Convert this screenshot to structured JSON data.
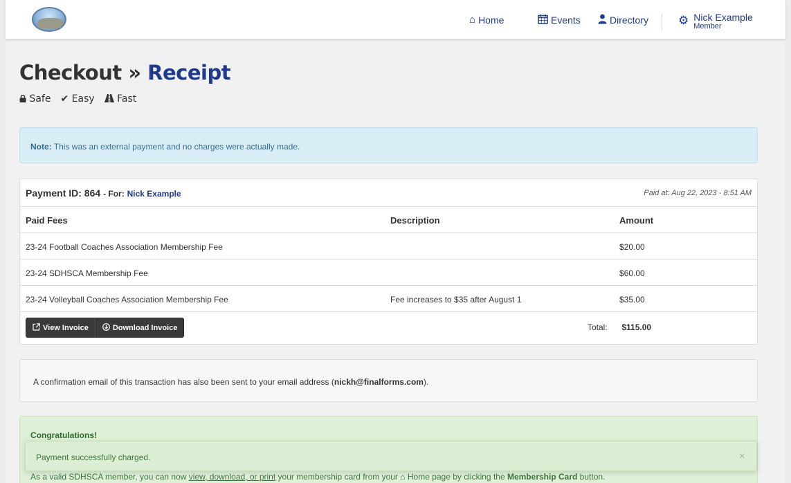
{
  "nav": {
    "home": "Home",
    "home_icon": "home-icon",
    "events": "Events",
    "events_icon": "calendar-icon",
    "directory": "Directory",
    "directory_icon": "user-icon",
    "user_name": "Nick Example",
    "user_role": "Member",
    "user_icon": "gear-icon"
  },
  "page": {
    "title_main": "Checkout »",
    "title_accent": "Receipt",
    "badges": [
      "Safe",
      "Easy",
      "Fast"
    ]
  },
  "note": {
    "label": "Note:",
    "text": "This was an external payment and no charges were actually made."
  },
  "receipt": {
    "payment_id_label": "Payment ID: 864",
    "for_label": "- For:",
    "for_name": "Nick Example",
    "paid_at": "Paid at: Aug 22, 2023 - 8:51 AM",
    "columns": [
      "Paid Fees",
      "Description",
      "Amount"
    ],
    "rows": [
      {
        "fee": "23-24 Football Coaches Association Membership Fee",
        "description": "",
        "amount": "$20.00"
      },
      {
        "fee": "23-24 SDHSCA Membership Fee",
        "description": "",
        "amount": "$60.00"
      },
      {
        "fee": "23-24 Volleyball Coaches Association Membership Fee",
        "description": "Fee increases to $35 after August 1",
        "amount": "$35.00"
      }
    ],
    "view_invoice": "View Invoice",
    "download_invoice": "Download Invoice",
    "total_label": "Total:",
    "total_value": "$115.00"
  },
  "confirmation": {
    "text_before": "A confirmation email of this transaction has also been sent to your email address (",
    "email": "nickh@finalforms.com",
    "text_after": ")."
  },
  "congrats": {
    "heading": "Congratulations!",
    "text_start": "As a valid SDHSCA member, you can now",
    "link": "view, download, or print",
    "text_mid": "your membership card from your",
    "home_link": "Home page",
    "text_end": "by clicking the",
    "card_button": "Membership Card",
    "text_tail": "button."
  },
  "toast": {
    "message": "Payment successfully charged.",
    "close": "×"
  },
  "colors": {
    "brand": "#1f3a8c",
    "info_bg": "#d9edf7",
    "success_bg": "#dff0d8",
    "button_dark": "#3a3a3a"
  }
}
